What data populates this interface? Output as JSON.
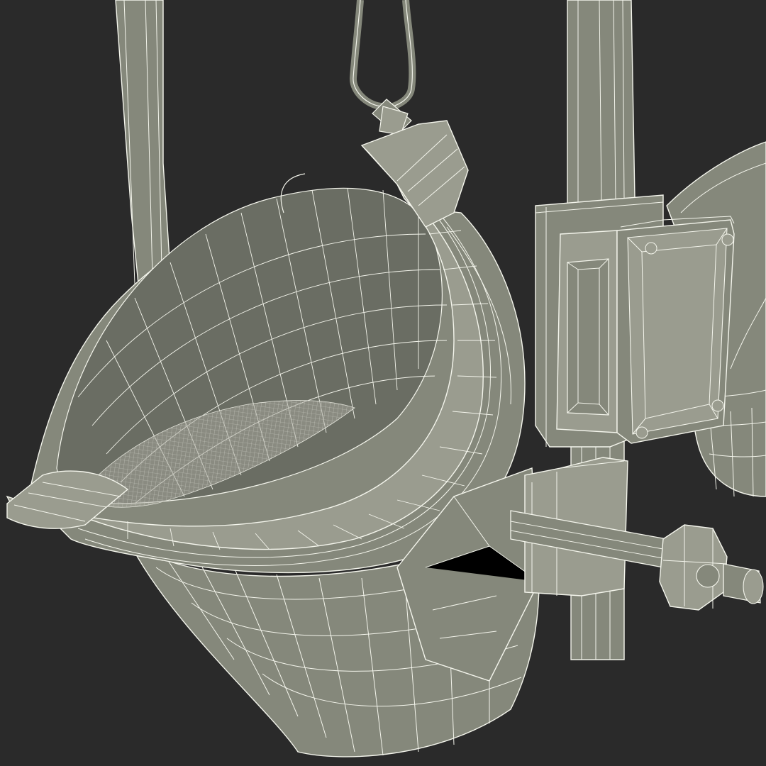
{
  "scene": {
    "subject": "ladle-wireframe-render",
    "background_color": "#2a2a2a",
    "surface_color": "#85887b",
    "surface_light_color": "#9a9c8f",
    "surface_dark_color": "#5c5f55",
    "wire_color": "#f4f5ec",
    "sand_color": "#a9aa9f"
  }
}
